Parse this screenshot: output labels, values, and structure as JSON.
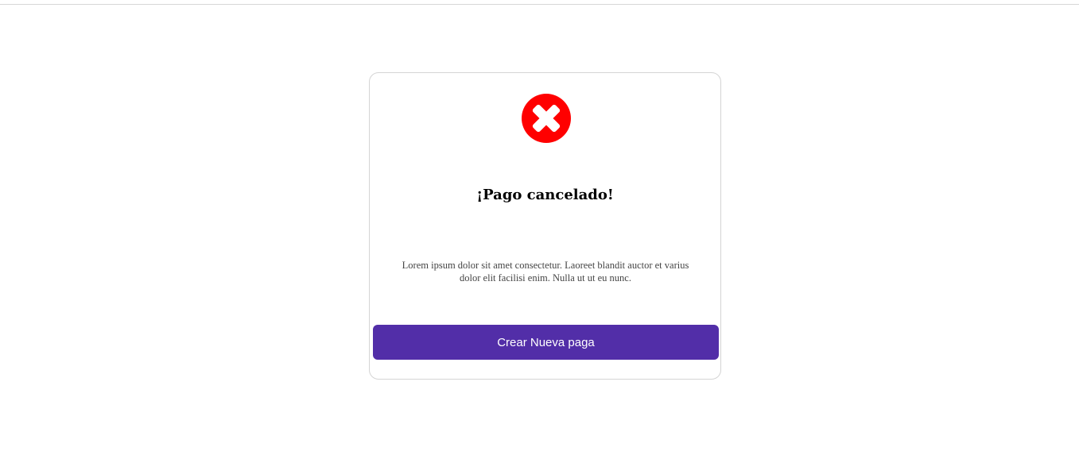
{
  "modal": {
    "icon": "close-circle-icon",
    "icon_color": "#ff0000",
    "title": "¡Pago cancelado!",
    "message": "Lorem ipsum dolor sit amet consectetur. Laoreet blandit auctor et varius dolor elit facilisi enim. Nulla ut ut eu nunc.",
    "button_label": "Crear Nueva paga",
    "button_color": "#522ea8"
  }
}
